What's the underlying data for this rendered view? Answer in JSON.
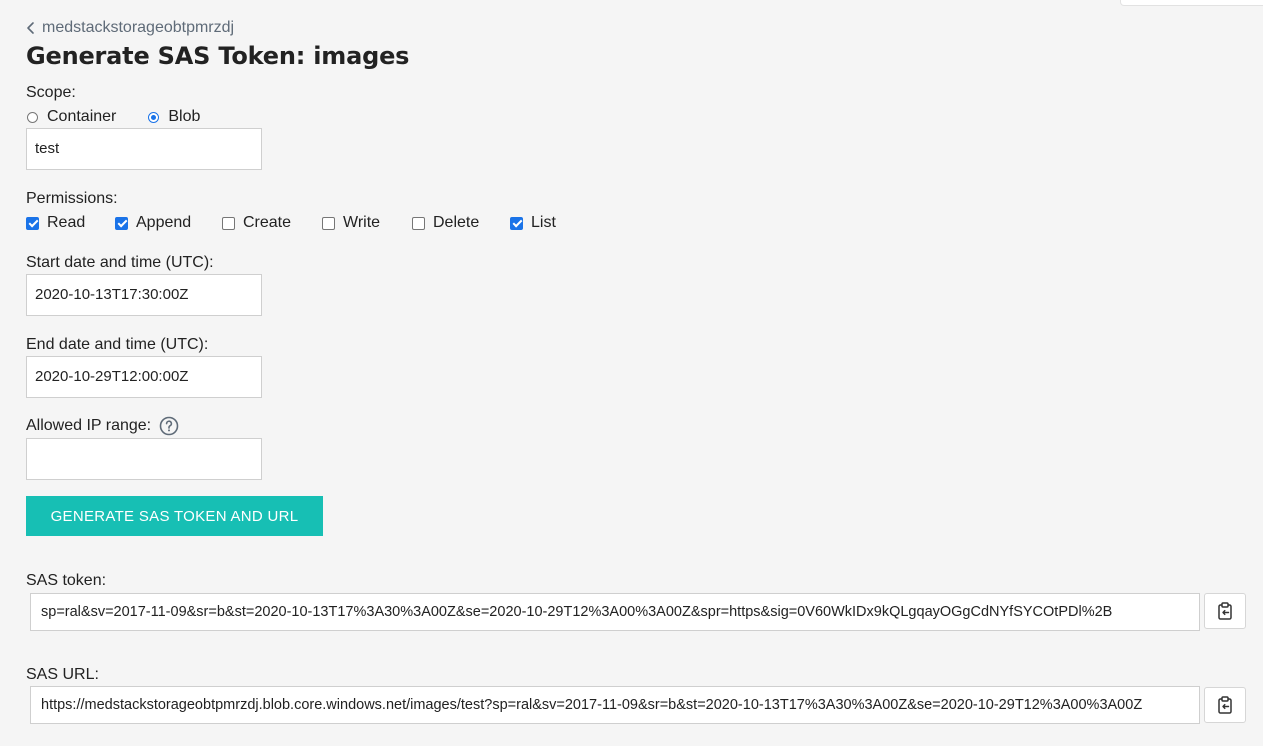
{
  "nav": {
    "back_label": "medstackstorageobtpmrzdj"
  },
  "page": {
    "title": "Generate SAS Token: images"
  },
  "scope": {
    "label": "Scope:",
    "options": [
      {
        "label": "Container",
        "selected": false
      },
      {
        "label": "Blob",
        "selected": true
      }
    ],
    "blob_name": "test"
  },
  "permissions": {
    "label": "Permissions:",
    "items": [
      {
        "label": "Read",
        "checked": true
      },
      {
        "label": "Append",
        "checked": true
      },
      {
        "label": "Create",
        "checked": false
      },
      {
        "label": "Write",
        "checked": false
      },
      {
        "label": "Delete",
        "checked": false
      },
      {
        "label": "List",
        "checked": true
      }
    ]
  },
  "start": {
    "label": "Start date and time (UTC):",
    "value": "2020-10-13T17:30:00Z"
  },
  "end": {
    "label": "End date and time (UTC):",
    "value": "2020-10-29T12:00:00Z"
  },
  "ip_range": {
    "label": "Allowed IP range:",
    "value": ""
  },
  "generate_button": {
    "label": "GENERATE SAS TOKEN AND URL"
  },
  "sas_token": {
    "label": "SAS token:",
    "value": "sp=ral&sv=2017-11-09&sr=b&st=2020-10-13T17%3A30%3A00Z&se=2020-10-29T12%3A00%3A00Z&spr=https&sig=0V60WkIDx9kQLgqayOGgCdNYfSYCOtPDl%2B"
  },
  "sas_url": {
    "label": "SAS URL:",
    "value": "https://medstackstorageobtpmrzdj.blob.core.windows.net/images/test?sp=ral&sv=2017-11-09&sr=b&st=2020-10-13T17%3A30%3A00Z&se=2020-10-29T12%3A00%3A00Z"
  },
  "icons": {
    "back": "chevron-left-icon",
    "help": "help-circle-icon",
    "copy": "clipboard-copy-icon"
  },
  "colors": {
    "background": "#f5f5f5",
    "accent": "#17bfb4",
    "control_blue": "#1a73e8",
    "muted_text": "#5f6b78"
  }
}
